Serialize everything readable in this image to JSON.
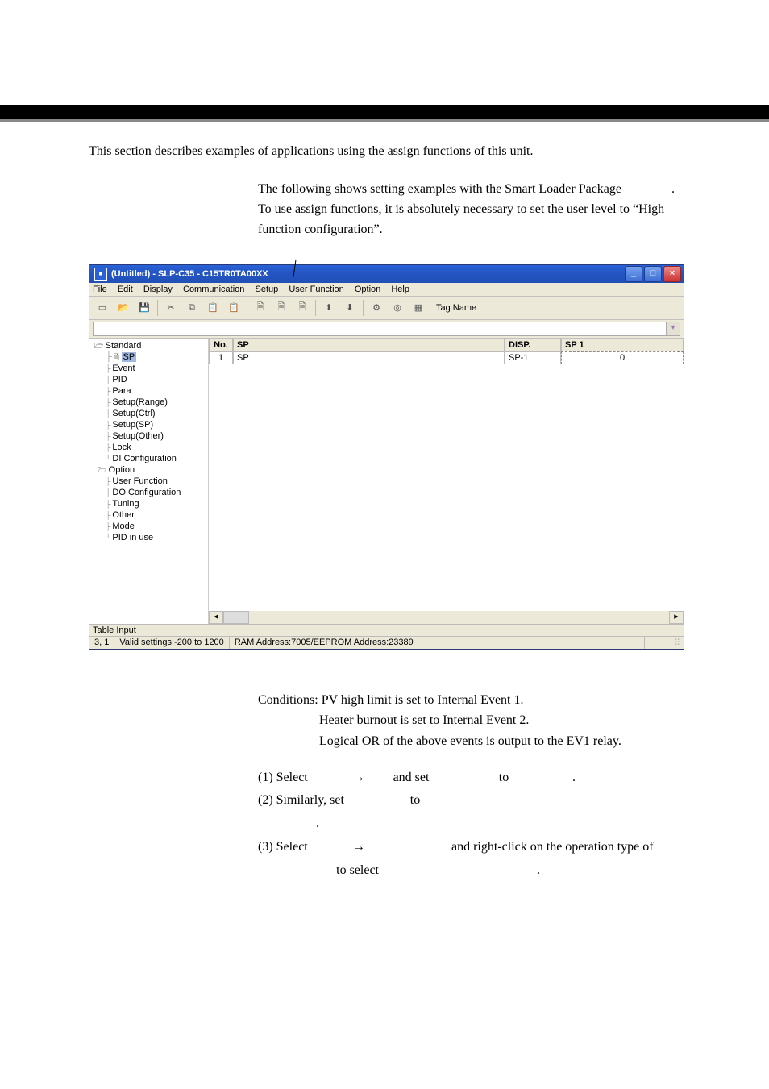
{
  "intro": "This section describes examples of applications using the assign functions of this unit.",
  "para1": "The following shows setting examples with the Smart Loader Package",
  "para1_tail": ".",
  "para2": "To use assign functions, it is absolutely necessary to set the user level to “High function configuration”.",
  "appwin": {
    "title": "(Untitled) - SLP-C35 - C15TR0TA00XX",
    "menus": {
      "file": "File",
      "edit": "Edit",
      "display": "Display",
      "communication": "Communication",
      "setup": "Setup",
      "userfunc": "User Function",
      "option": "Option",
      "help": "Help"
    },
    "toolbar": {
      "tagname_label": "Tag Name"
    },
    "tree": {
      "standard": "Standard",
      "sp": "SP",
      "event": "Event",
      "pid": "PID",
      "para": "Para",
      "setup_range": "Setup(Range)",
      "setup_ctrl": "Setup(Ctrl)",
      "setup_sp": "Setup(SP)",
      "setup_other": "Setup(Other)",
      "lock": "Lock",
      "di_config": "DI Configuration",
      "option": "Option",
      "user_function": "User Function",
      "do_config": "DO Configuration",
      "tuning": "Tuning",
      "other": "Other",
      "mode": "Mode",
      "pid_in_use": "PID in use"
    },
    "grid": {
      "head_no": "No.",
      "head_sp": "SP",
      "head_disp": "DISP.",
      "head_sp1": "SP 1",
      "row1_no": "1",
      "row1_sp": "SP",
      "row1_disp": "SP-1",
      "row1_sp1": "0"
    },
    "status_a": "Table Input",
    "status_b": {
      "cell": "3, 1",
      "valid": "Valid settings:-200 to 1200",
      "ram": "RAM Address:7005/EEPROM Address:23389"
    }
  },
  "conditions": {
    "label": "Conditions: ",
    "c1": "PV high limit is set to Internal Event 1.",
    "c2": "Heater burnout is set to Internal Event 2.",
    "c3": "Logical OR of the above events is output to the EV1 relay."
  },
  "steps": {
    "s1a": "(1) Select",
    "s1_arrow": "→",
    "s1b": "and set",
    "s1c": "to",
    "s1d": ".",
    "s2a": "(2) Similarly, set",
    "s2b": "to",
    "s2c": ".",
    "s3a": "(3) Select",
    "s3_arrow": "→",
    "s3b": "and right-click on the operation type of",
    "s3c": "to select",
    "s3d": "."
  }
}
